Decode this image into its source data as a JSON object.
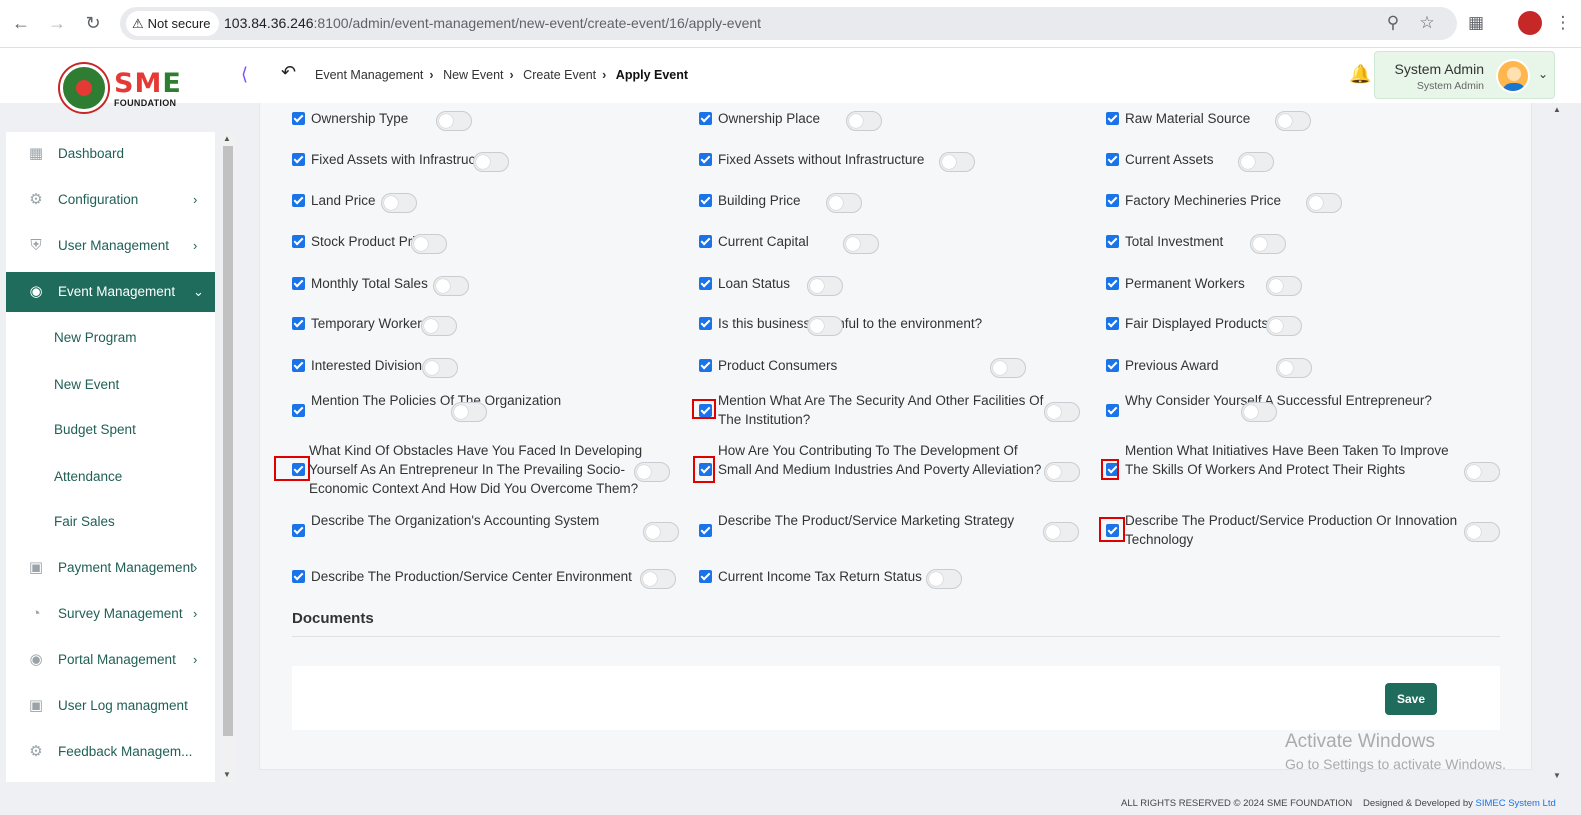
{
  "browser": {
    "secure_label": "Not secure",
    "url_host": "103.84.36.246",
    "url_rest": ":8100/admin/event-management/new-event/create-event/16/apply-event"
  },
  "header": {
    "logo_text_s": "S",
    "logo_text_m": "M",
    "logo_text_e": "E",
    "logo_sub": "FOUNDATION",
    "breadcrumb": [
      "Event Management",
      "New Event",
      "Create Event",
      "Apply Event"
    ],
    "user_name": "System Admin",
    "user_role": "System Admin"
  },
  "sidebar": {
    "items": [
      {
        "label": "Dashboard",
        "icon": "grid-icon"
      },
      {
        "label": "Configuration",
        "icon": "config-icon"
      },
      {
        "label": "User Management",
        "icon": "user-shield-icon"
      },
      {
        "label": "Event Management",
        "icon": "event-icon"
      },
      {
        "label": "Payment Management",
        "icon": "payment-icon"
      },
      {
        "label": "Survey Management",
        "icon": "pie-icon"
      },
      {
        "label": "Portal Management",
        "icon": "portal-icon"
      },
      {
        "label": "User Log managment",
        "icon": "log-icon"
      },
      {
        "label": "Feedback Managem...",
        "icon": "feedback-icon"
      }
    ],
    "sub_items": [
      "New Program",
      "New Event",
      "Budget Spent",
      "Attendance",
      "Fair Sales"
    ]
  },
  "fields": [
    {
      "label": "Ownership Type",
      "checked": true,
      "enabled": false
    },
    {
      "label": "Ownership Place",
      "checked": true,
      "enabled": false
    },
    {
      "label": "Raw Material Source",
      "checked": true,
      "enabled": false
    },
    {
      "label": "Fixed Assets with Infrastructure",
      "checked": true,
      "enabled": false
    },
    {
      "label": "Fixed Assets without Infrastructure",
      "checked": true,
      "enabled": false
    },
    {
      "label": "Current Assets",
      "checked": true,
      "enabled": false
    },
    {
      "label": "Land Price",
      "checked": true,
      "enabled": false
    },
    {
      "label": "Building Price",
      "checked": true,
      "enabled": false
    },
    {
      "label": "Factory Mechineries Price",
      "checked": true,
      "enabled": false
    },
    {
      "label": "Stock Product Price",
      "checked": true,
      "enabled": false
    },
    {
      "label": "Current Capital",
      "checked": true,
      "enabled": false
    },
    {
      "label": "Total Investment",
      "checked": true,
      "enabled": false
    },
    {
      "label": "Monthly Total Sales",
      "checked": true,
      "enabled": false
    },
    {
      "label": "Loan Status",
      "checked": true,
      "enabled": false
    },
    {
      "label": "Permanent Workers",
      "checked": true,
      "enabled": false
    },
    {
      "label": "Temporary Workers",
      "checked": true,
      "enabled": false
    },
    {
      "label": "Is this business harmful to the environment?",
      "checked": true,
      "enabled": false
    },
    {
      "label": "Fair Displayed Products",
      "checked": true,
      "enabled": false
    },
    {
      "label": "Interested Division Fair",
      "checked": true,
      "enabled": false
    },
    {
      "label": "Product Consumers",
      "checked": true,
      "enabled": false
    },
    {
      "label": "Previous Award",
      "checked": true,
      "enabled": false
    },
    {
      "label": "Mention The Policies Of The Organization",
      "checked": true,
      "enabled": false
    },
    {
      "label": "Mention What Are The Security And Other Facilities Of The Institution?",
      "checked": true,
      "enabled": false
    },
    {
      "label": "Why Consider Yourself A Successful Entrepreneur?",
      "checked": true,
      "enabled": false
    },
    {
      "label": "What Kind Of Obstacles Have You Faced In Developing Yourself As An Entrepreneur In The Prevailing Socio-Economic Context And How Did You Overcome Them?",
      "checked": true,
      "enabled": false
    },
    {
      "label": "How Are You Contributing To The Development Of Small And Medium Industries And Poverty Alleviation?",
      "checked": true,
      "enabled": false
    },
    {
      "label": "Mention What Initiatives Have Been Taken To Improve The Skills Of Workers And Protect Their Rights",
      "checked": true,
      "enabled": false
    },
    {
      "label": "Describe The Organization's Accounting System",
      "checked": true,
      "enabled": false
    },
    {
      "label": "Describe The Product/Service Marketing Strategy",
      "checked": true,
      "enabled": false
    },
    {
      "label": "Describe The Product/Service Production Or Innovation Technology",
      "checked": true,
      "enabled": false
    },
    {
      "label": "Describe The Production/Service Center Environment",
      "checked": true,
      "enabled": false
    },
    {
      "label": "Current Income Tax Return Status",
      "checked": true,
      "enabled": false
    }
  ],
  "documents": {
    "title": "Documents",
    "save_label": "Save"
  },
  "watermark": {
    "line1": "Activate Windows",
    "line2": "Go to Settings to activate Windows."
  },
  "footer": {
    "rights": "ALL RIGHTS RESERVED © 2024 SME FOUNDATION",
    "designed": "Designed & Developed by",
    "company": "SIMEC System Ltd"
  },
  "colors": {
    "accent": "#1f6b5c",
    "checkbox": "#1a73e8",
    "highlight": "#e00000"
  }
}
